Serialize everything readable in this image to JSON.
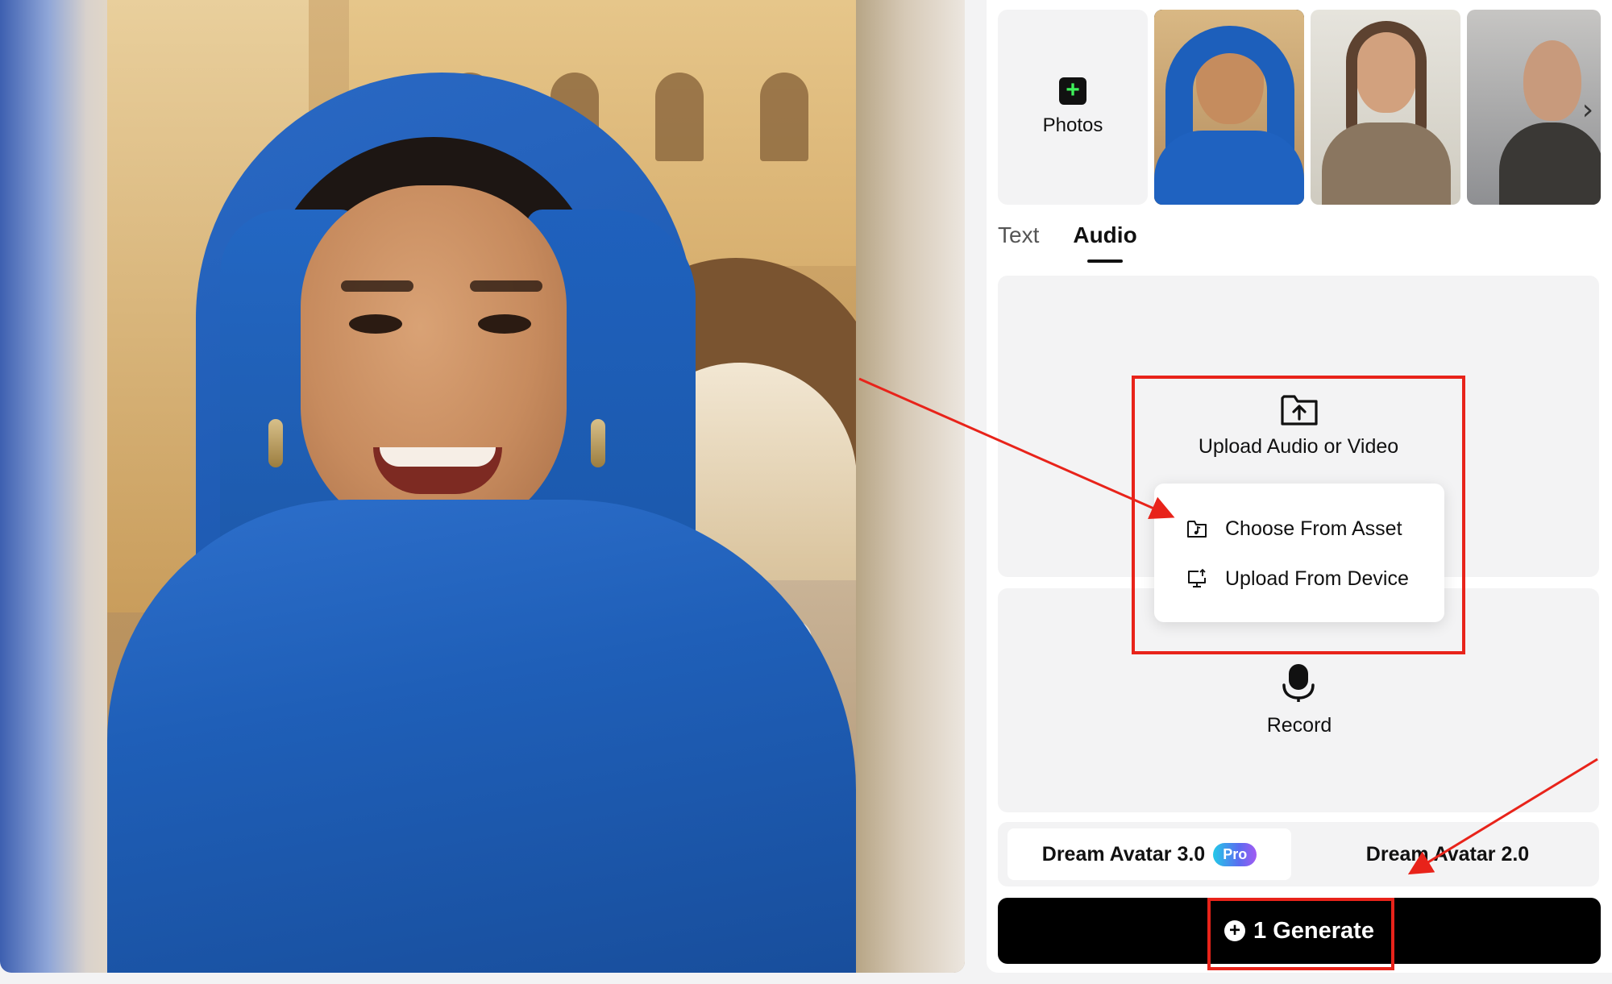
{
  "photos": {
    "add_label": "Photos",
    "add_icon": "plus-icon",
    "next_icon": "chevron-right-icon"
  },
  "tabs": [
    {
      "label": "Text",
      "active": false
    },
    {
      "label": "Audio",
      "active": true
    }
  ],
  "upload": {
    "icon": "folder-upload-icon",
    "label": "Upload Audio or Video",
    "menu": [
      {
        "label": "Choose From Asset",
        "icon": "folder-music-icon"
      },
      {
        "label": "Upload From Device",
        "icon": "monitor-upload-icon"
      }
    ]
  },
  "record": {
    "icon": "microphone-icon",
    "label": "Record"
  },
  "models": [
    {
      "label": "Dream Avatar 3.0",
      "badge": "Pro",
      "active": true
    },
    {
      "label": "Dream Avatar 2.0",
      "active": false
    }
  ],
  "generate": {
    "icon": "plus-circle-icon",
    "label": "1 Generate"
  },
  "colors": {
    "annotation": "#e8231a",
    "accent_green": "#3ef05a",
    "button_bg": "#000000"
  }
}
